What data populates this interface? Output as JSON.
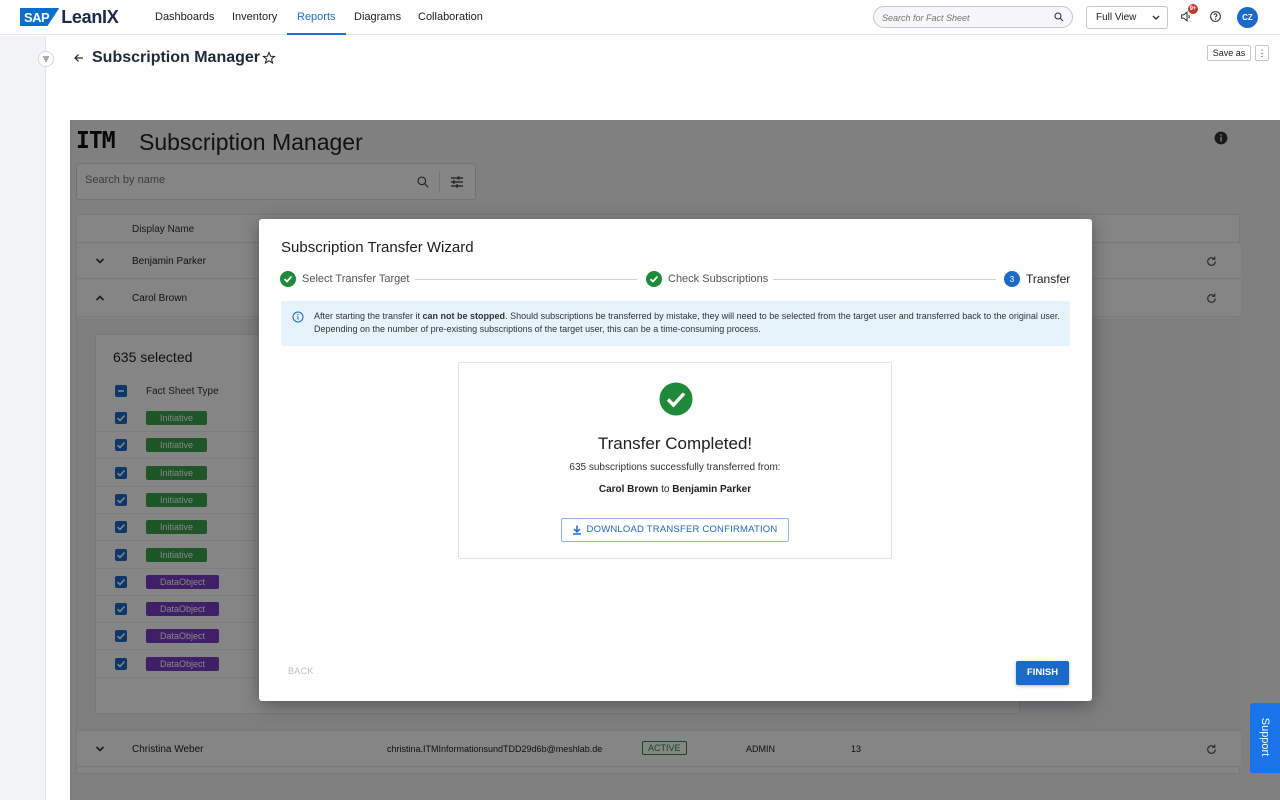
{
  "nav": {
    "brand_sap": "SAP",
    "brand_product": "LeanIX",
    "links": [
      "Dashboards",
      "Inventory",
      "Reports",
      "Diagrams",
      "Collaboration"
    ],
    "active": "Reports",
    "search_placeholder": "Search for Fact Sheet",
    "view_select": "Full View",
    "notification_badge": "9+",
    "avatar_initials": "CZ"
  },
  "page": {
    "title": "Subscription Manager",
    "save_as": "Save as",
    "more": "⋮"
  },
  "report": {
    "logo": "ITM",
    "title": "Subscription Manager",
    "search_placeholder": "Search by name",
    "column_display_name": "Display Name",
    "rows": [
      {
        "name": "Benjamin Parker"
      },
      {
        "name": "Carol Brown"
      }
    ],
    "detail": {
      "selected": "635 selected",
      "column_fact_sheet_type": "Fact Sheet Type",
      "items": [
        "Initiative",
        "Initiative",
        "Initiative",
        "Initiative",
        "Initiative",
        "Initiative",
        "DataObject",
        "DataObject",
        "DataObject",
        "DataObject"
      ]
    },
    "last_row": {
      "name": "Christina Weber",
      "email": "christina.ITMInformationsundTDD29d6b@meshlab.de",
      "status": "ACTIVE",
      "role": "ADMIN",
      "count": "13"
    }
  },
  "modal": {
    "title": "Subscription Transfer Wizard",
    "steps": [
      {
        "label": "Select Transfer Target",
        "state": "done"
      },
      {
        "label": "Check Subscriptions",
        "state": "done"
      },
      {
        "label": "Transfer",
        "state": "current",
        "number": "3"
      }
    ],
    "alert_pre": "After starting the transfer it ",
    "alert_bold": "can not be stopped",
    "alert_post": ". Should subscriptions be transferred by mistake, they will need to be selected from the target user and transferred back to the original user. Depending on the number of pre-existing subscriptions of the target user, this can be a time-consuming process.",
    "result_title": "Transfer Completed!",
    "result_text": "635 subscriptions successfully transferred from:",
    "from_user": "Carol Brown",
    "to_word": "to",
    "to_user": "Benjamin Parker",
    "download_label": "DOWNLOAD TRANSFER CONFIRMATION",
    "back_label": "BACK",
    "finish_label": "FINISH"
  },
  "support_label": "Support",
  "colors": {
    "accent": "#1b6ac9",
    "success": "#1f8a3a",
    "initiative_tag": "#3aa450",
    "dataobject_tag": "#7a3fc7"
  }
}
